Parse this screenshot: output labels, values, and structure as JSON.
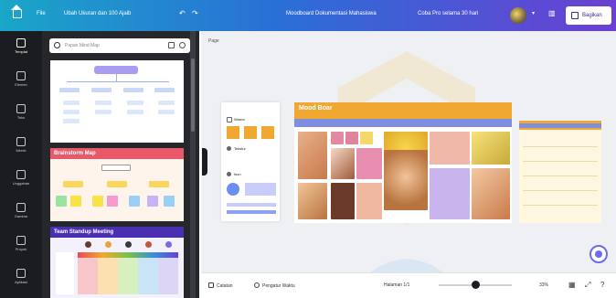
{
  "header": {
    "file_menu": "File",
    "resize": "Ubah Ukuran dan 100 Ajaib",
    "doc_title": "Moodboard Dokumentasi Mahasiswa",
    "upgrade": "Coba Pro selama 30 hari",
    "share": "Bagikan",
    "gradient_start": "#1aa6c8",
    "gradient_end": "#6b3fd3"
  },
  "rail": {
    "items": [
      {
        "label": "Templat",
        "icon": "template-icon"
      },
      {
        "label": "Elemen",
        "icon": "elements-icon"
      },
      {
        "label": "Teks",
        "icon": "text-icon"
      },
      {
        "label": "Merek",
        "icon": "brand-icon"
      },
      {
        "label": "Unggahan",
        "icon": "upload-icon"
      },
      {
        "label": "Gambar",
        "icon": "draw-icon"
      },
      {
        "label": "Proyek",
        "icon": "projects-icon"
      },
      {
        "label": "Aplikasi",
        "icon": "apps-icon"
      }
    ]
  },
  "panel": {
    "search_placeholder": "Papan Mind Map",
    "templates": [
      {
        "title": "",
        "accent": "#6a5ae0"
      },
      {
        "title": "Brainstorm Map",
        "accent": "#e85a6a"
      },
      {
        "title": "Team Standup Meeting",
        "accent": "#4b2fb3"
      }
    ]
  },
  "canvas": {
    "page_label": "Page",
    "moodboard_title": "Mood Boar",
    "moodboard_subtitle": "",
    "card_labels": [
      "Warna",
      "Tekstur",
      "Ikon"
    ]
  },
  "bottom": {
    "notes": "Catatan",
    "timer": "Pengatur Waktu",
    "page_count": "Halaman 1/1",
    "zoom": "33%"
  }
}
